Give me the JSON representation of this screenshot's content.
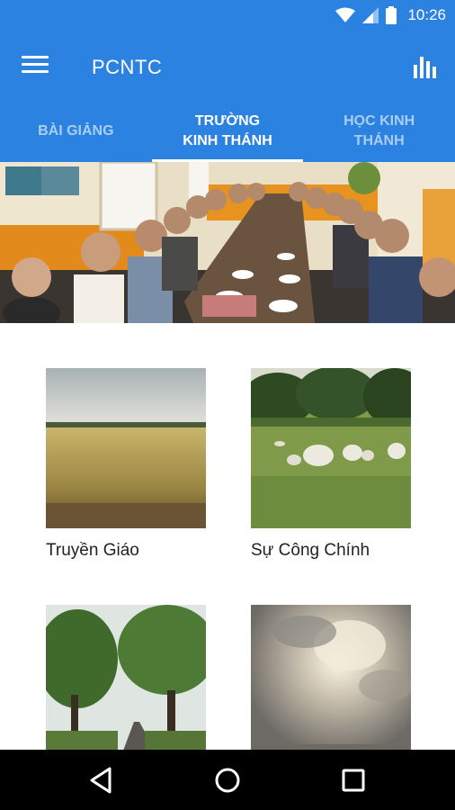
{
  "status": {
    "time": "10:26"
  },
  "app": {
    "title": "PCNTC"
  },
  "tabs": [
    {
      "label": "BÀI GIẢNG",
      "active": false
    },
    {
      "label": "TRƯỜNG\nKINH THÁNH",
      "active": true
    },
    {
      "label": "HỌC KINH\nTHÁNH",
      "active": false
    }
  ],
  "cards": [
    {
      "label": "Truyền Giáo",
      "image": "wheat-field"
    },
    {
      "label": "Sự Công Chính",
      "image": "sheep-meadow"
    },
    {
      "label": "",
      "image": "tree-lined-road"
    },
    {
      "label": "",
      "image": "sunlit-clouds"
    }
  ],
  "colors": {
    "primary": "#2b82e0",
    "navbar": "#000000"
  }
}
